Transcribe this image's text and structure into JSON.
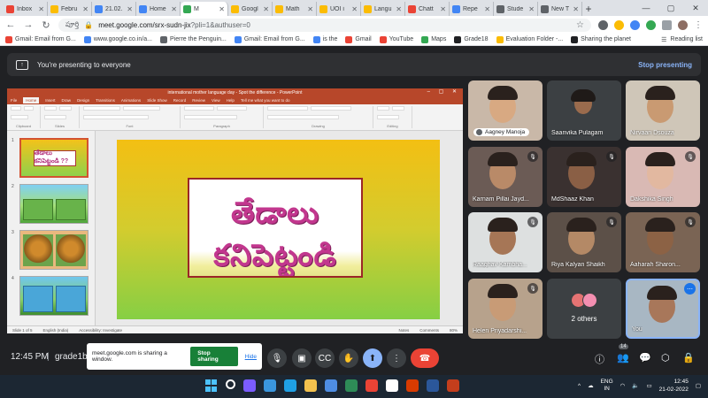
{
  "browser": {
    "tabs": [
      {
        "label": "Inbox",
        "color": "#ea4335"
      },
      {
        "label": "Febru",
        "color": "#fbbc04"
      },
      {
        "label": "21.02.",
        "color": "#4285f4"
      },
      {
        "label": "Home",
        "color": "#4285f4"
      },
      {
        "label": "M",
        "color": "#34a853",
        "active": true
      },
      {
        "label": "Googl",
        "color": "#fbbc04"
      },
      {
        "label": "Math",
        "color": "#fbbc04"
      },
      {
        "label": "UOI i",
        "color": "#fbbc04"
      },
      {
        "label": "Langu",
        "color": "#fbbc04"
      },
      {
        "label": "Chatt",
        "color": "#ea4335"
      },
      {
        "label": "Repe",
        "color": "#4285f4"
      },
      {
        "label": "Stude",
        "color": "#5f6368"
      },
      {
        "label": "New T",
        "color": "#5f6368"
      }
    ],
    "address": {
      "badge": "పూర్తి",
      "url_host": "meet.google.com/srx-sudn-jix",
      "url_query": "?pli=1&authuser=0"
    },
    "bookmarks": [
      {
        "label": "Gmail: Email from G...",
        "color": "#ea4335"
      },
      {
        "label": "www.google.co.in/a...",
        "color": "#4285f4"
      },
      {
        "label": "Pierre the Penguin...",
        "color": "#5f6368"
      },
      {
        "label": "Gmail: Email from G...",
        "color": "#4285f4"
      },
      {
        "label": "is the",
        "color": "#4285f4"
      },
      {
        "label": "Gmail",
        "color": "#ea4335"
      },
      {
        "label": "YouTube",
        "color": "#ea4335"
      },
      {
        "label": "Maps",
        "color": "#34a853"
      },
      {
        "label": "Grade18",
        "color": "#202124"
      },
      {
        "label": "Evaluation Folder -...",
        "color": "#fbbc04"
      },
      {
        "label": "Sharing the planet",
        "color": "#202124"
      }
    ],
    "reading_list": "Reading list"
  },
  "meet": {
    "banner_text": "You're presenting to everyone",
    "stop_presenting": "Stop presenting",
    "time": "12:45 PM",
    "separator": "|",
    "meeting_code": "grade1b",
    "share_notice": "meet.google.com is sharing a window.",
    "stop_sharing": "Stop sharing",
    "hide": "Hide",
    "people_count": "14",
    "participants": [
      {
        "name": "Aagney Manoja",
        "bg": "#c9b8a8",
        "skin": "#d8a982",
        "muted": false,
        "pinned_label": true
      },
      {
        "name": "Saanvika Pulagam",
        "bg": "#3c4043",
        "skin": "#9a6b4d",
        "muted": false
      },
      {
        "name": "Nirvaan Dsouza",
        "bg": "#cfc6b8",
        "skin": "#c99a72",
        "muted": false
      },
      {
        "name": "Karnam Pillai Jayd...",
        "bg": "#6b5b55",
        "skin": "#b98a68",
        "muted": true
      },
      {
        "name": "MdShaaz Khan",
        "bg": "#3a3130",
        "skin": "#8a5f45",
        "muted": true
      },
      {
        "name": "Dakshika Singh",
        "bg": "#d9b9b4",
        "skin": "#e2b8a0",
        "muted": true
      },
      {
        "name": "Raaghav Kambha...",
        "bg": "#dde0e0",
        "skin": "#a67656",
        "muted": true
      },
      {
        "name": "Riya Kalyan Shaikh",
        "bg": "#5c5048",
        "skin": "#b48966",
        "muted": true
      },
      {
        "name": "Aaharah Sharon...",
        "bg": "#7a6454",
        "skin": "#8c6245",
        "muted": true
      },
      {
        "name": "Helen Priyadarshi...",
        "bg": "#b7a28c",
        "skin": "#c89b76",
        "muted": true
      },
      {
        "name": "2 others",
        "bg": "#3c4043"
      },
      {
        "name": "You",
        "bg": "#a8b7c3",
        "skin": "#a8775a",
        "muted": false
      }
    ]
  },
  "powerpoint": {
    "title": "international mother language day - Spot the difference - PowerPoint",
    "ribbon_tabs": [
      "File",
      "Home",
      "Insert",
      "Draw",
      "Design",
      "Transitions",
      "Animations",
      "Slide Show",
      "Record",
      "Review",
      "View",
      "Help",
      "Tell me what you want to do"
    ],
    "active_tab": "Home",
    "groups": [
      "Clipboard",
      "Slides",
      "Font",
      "Paragraph",
      "Drawing",
      "Editing"
    ],
    "thumb1_text": "తేడాలు కనిపెట్టండి ??",
    "slide_numbers": [
      "1",
      "2",
      "3",
      "4"
    ],
    "slide_text": "తేడాలు కనిపెట్టండి ??",
    "status_left": "Slide 1 of 5",
    "status_lang": "English (India)",
    "status_access": "Accessibility: Investigate",
    "status_notes": "Notes",
    "status_comments": "Comments",
    "zoom": "80%"
  },
  "taskbar": {
    "lang_top": "ENG",
    "lang_bottom": "IN",
    "clock_time": "12:45",
    "clock_date": "21-02-2022",
    "icon_colors": [
      "#4cc2ff",
      "#ffffff",
      "#7a5cff",
      "#3a96dd",
      "#1fa0e5",
      "#f2c14e",
      "#4e8de3",
      "#2e8b57",
      "#ea4335",
      "#ffffff",
      "#d83b01",
      "#2b579a",
      "#c43e1c"
    ]
  }
}
